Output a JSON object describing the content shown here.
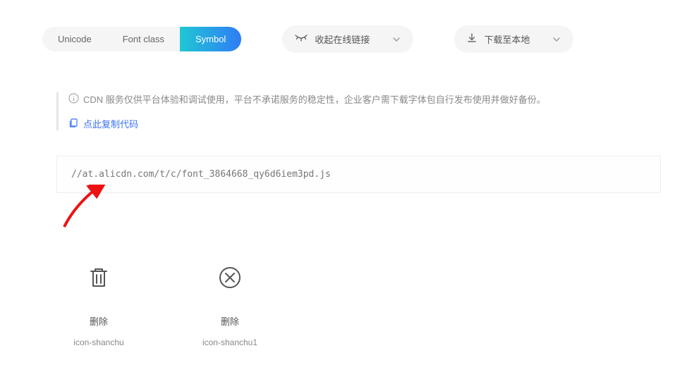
{
  "tabs": {
    "items": [
      "Unicode",
      "Font class",
      "Symbol"
    ],
    "active_index": 2
  },
  "actions": {
    "collapse": {
      "label": "收起在线链接"
    },
    "download": {
      "label": "下载至本地"
    }
  },
  "notice": {
    "text": "CDN 服务仅供平台体验和调试使用，平台不承诺服务的稳定性，企业客户需下载字体包自行发布使用并做好备份。",
    "copy_label": "点此复制代码"
  },
  "code": {
    "url": "//at.alicdn.com/t/c/font_3864668_qy6d6iem3pd.js"
  },
  "icons": [
    {
      "label": "删除",
      "class": "icon-shanchu",
      "glyph": "trash"
    },
    {
      "label": "删除",
      "class": "icon-shanchu1",
      "glyph": "x-circle"
    }
  ]
}
